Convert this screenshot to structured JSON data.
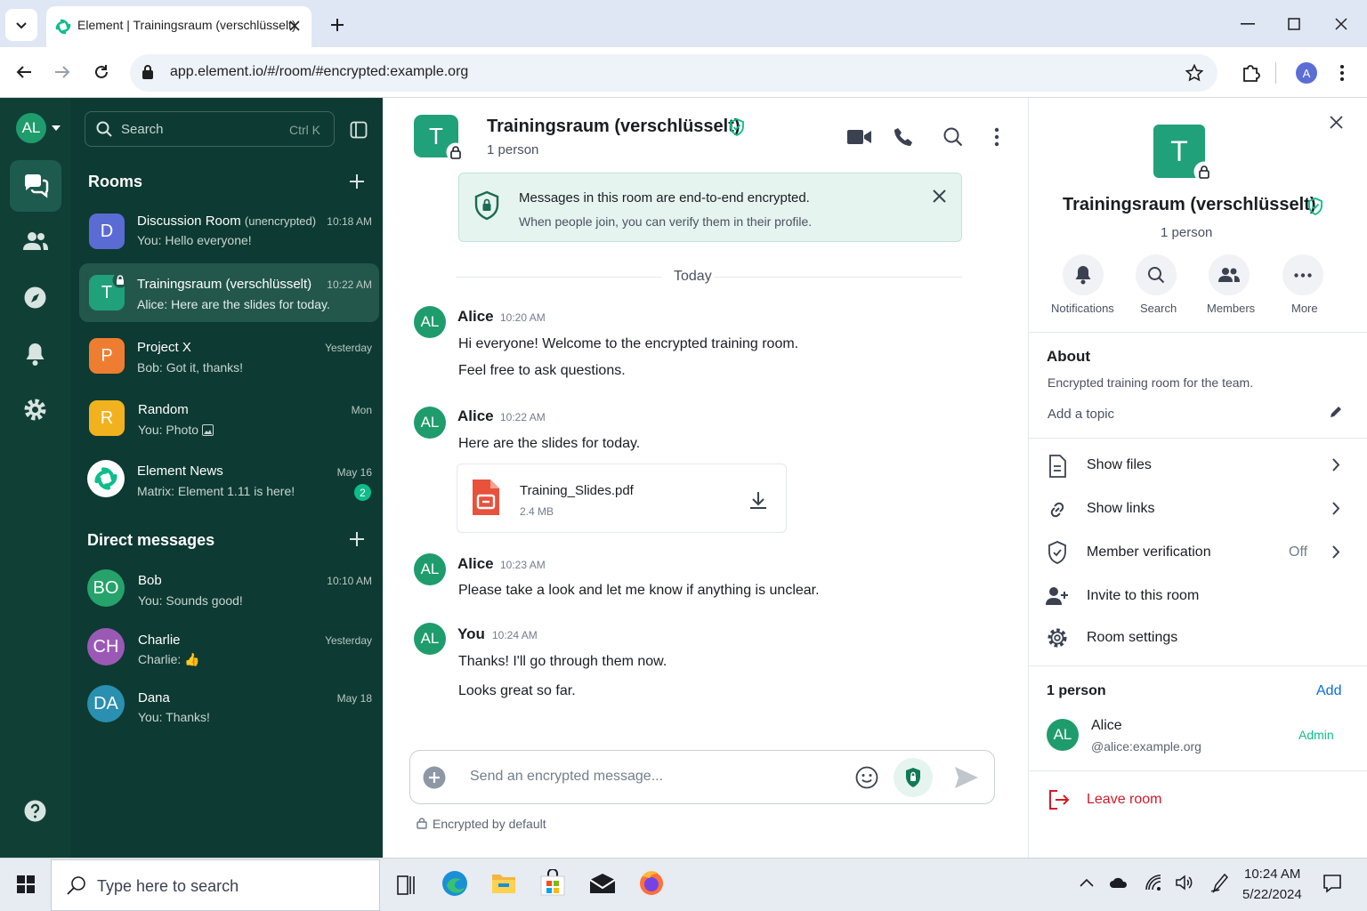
{
  "browser": {
    "tab_title": "Element | Trainingsraum (verschlüsselt)",
    "url": "app.element.io/#/room/#encrypted:example.org",
    "profile_initial": "A"
  },
  "colors": {
    "accent": "#0dbd8b",
    "sidebar": "#0d3a32",
    "rail": "#103f36",
    "danger": "#d51928",
    "link": "#0a6fd8"
  },
  "rail": {
    "user_initials": "AL"
  },
  "search": {
    "placeholder": "Search",
    "shortcut": "Ctrl K"
  },
  "rooms": {
    "heading": "Rooms",
    "items": [
      {
        "initial": "D",
        "name": "Discussion Room",
        "tag": "(unencrypted)",
        "time": "10:18 AM",
        "preview": "You: Hello everyone!",
        "color": "#5b6bd4"
      },
      {
        "initial": "T",
        "name": "Trainingsraum",
        "tag": "(verschlüsselt)",
        "time": "10:22 AM",
        "preview": "Alice: Here are the slides for today.",
        "color": "#20a17a"
      },
      {
        "initial": "P",
        "name": "Project X",
        "tag": "",
        "time": "Yesterday",
        "preview": "Bob: Got it, thanks!",
        "color": "#ef7d31"
      },
      {
        "initial": "R",
        "name": "Random",
        "tag": "",
        "time": "Mon",
        "preview": "You: Photo",
        "color": "#f2b21d"
      },
      {
        "initial": "",
        "name": "Element News",
        "tag": "",
        "time": "May 16",
        "preview": "Matrix: Element 1.11 is here!",
        "badge": "2",
        "color": "#ffffff"
      }
    ]
  },
  "dms": {
    "heading": "Direct messages",
    "items": [
      {
        "initial": "BO",
        "name": "Bob",
        "time": "10:10 AM",
        "preview": "You: Sounds good!",
        "color": "#25a36b"
      },
      {
        "initial": "CH",
        "name": "Charlie",
        "time": "Yesterday",
        "preview": "Charlie: 👍",
        "color": "#9b59b6"
      },
      {
        "initial": "DA",
        "name": "Dana",
        "time": "May 18",
        "preview": "You: Thanks!",
        "color": "#2a8fb0"
      }
    ]
  },
  "room": {
    "initial": "T",
    "name": "Trainingsraum (verschlüsselt)",
    "members": "1 person"
  },
  "banner": {
    "title": "Messages in this room are end-to-end encrypted.",
    "body": "When people join, you can verify them in their profile."
  },
  "timeline": {
    "date_separator": "Today",
    "messages": [
      {
        "avatar": "AL",
        "sender": "Alice",
        "time": "10:20 AM",
        "lines": [
          "Hi everyone! Welcome to the encrypted training room.",
          "Feel free to ask questions."
        ]
      },
      {
        "avatar": "AL",
        "sender": "Alice",
        "time": "10:22 AM",
        "lines": [
          "Here are the slides for today."
        ]
      },
      {
        "avatar": "AL",
        "sender": "Alice",
        "time": "10:23 AM",
        "lines": [
          "Please take a look and let me know if anything is unclear."
        ]
      },
      {
        "avatar": "AL",
        "sender": "You",
        "time": "10:24 AM",
        "lines": [
          "Thanks! I'll go through them now.",
          "Looks great so far."
        ]
      }
    ],
    "file": {
      "name": "Training_Slides.pdf",
      "size": "2.4 MB"
    }
  },
  "composer": {
    "placeholder": "Send an encrypted message...",
    "footer": "Encrypted by default"
  },
  "panel": {
    "room_initial": "T",
    "room_name": "Trainingsraum (verschlüsselt)",
    "members": "1 person",
    "actions": [
      {
        "label": "Notifications",
        "icon": "bell-icon"
      },
      {
        "label": "Search",
        "icon": "search-icon"
      },
      {
        "label": "Members",
        "icon": "people-icon"
      },
      {
        "label": "More",
        "icon": "more-icon"
      }
    ],
    "about_heading": "About",
    "about_text": "Encrypted training room for the team.",
    "topic_placeholder": "Add a topic",
    "menu": [
      {
        "label": "Show files",
        "icon": "file-icon",
        "value": ""
      },
      {
        "label": "Show links",
        "icon": "link-icon",
        "value": ""
      },
      {
        "label": "Member verification",
        "icon": "shield-icon",
        "value": "Off"
      },
      {
        "label": "Invite to this room",
        "icon": "invite-icon",
        "value": ""
      },
      {
        "label": "Room settings",
        "icon": "gear-icon",
        "value": ""
      }
    ],
    "people_heading": "1 person",
    "add_label": "Add",
    "member": {
      "initials": "AL",
      "name": "Alice",
      "id": "@alice:example.org",
      "role": "Admin"
    },
    "leave_label": "Leave room"
  },
  "taskbar": {
    "search_placeholder": "Type here to search",
    "time": "10:24 AM",
    "date": "5/22/2024"
  }
}
